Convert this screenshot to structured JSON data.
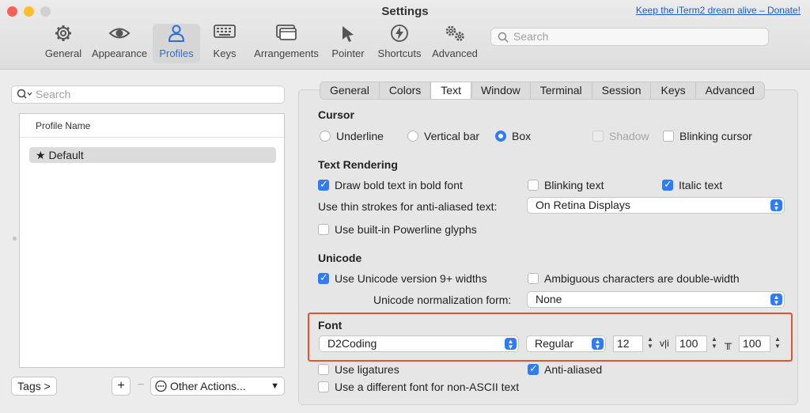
{
  "window": {
    "title": "Settings",
    "donate_link": "Keep the iTerm2 dream alive – Donate!"
  },
  "toolbar": {
    "items": [
      {
        "label": "General",
        "icon": "gear-icon"
      },
      {
        "label": "Appearance",
        "icon": "eye-icon"
      },
      {
        "label": "Profiles",
        "icon": "person-icon"
      },
      {
        "label": "Keys",
        "icon": "keyboard-icon"
      },
      {
        "label": "Arrangements",
        "icon": "windows-icon"
      },
      {
        "label": "Pointer",
        "icon": "pointer-icon"
      },
      {
        "label": "Shortcuts",
        "icon": "bolt-icon"
      },
      {
        "label": "Advanced",
        "icon": "gears-icon"
      }
    ],
    "selected": "Profiles",
    "search_placeholder": "Search"
  },
  "profiles": {
    "search_placeholder": "Search",
    "column_header": "Profile Name",
    "items": [
      {
        "name": "Default",
        "star": "★"
      }
    ],
    "tags_button": "Tags >",
    "add_button": "+",
    "remove_button": "−",
    "other_actions": "Other Actions..."
  },
  "tabs": [
    "General",
    "Colors",
    "Text",
    "Window",
    "Terminal",
    "Session",
    "Keys",
    "Advanced"
  ],
  "active_tab": "Text",
  "cursor": {
    "title": "Cursor",
    "options": [
      "Underline",
      "Vertical bar",
      "Box"
    ],
    "selected": "Box",
    "shadow": "Shadow",
    "blinking": "Blinking cursor"
  },
  "text_rendering": {
    "title": "Text Rendering",
    "bold": "Draw bold text in bold font",
    "blinking_text": "Blinking text",
    "italic": "Italic text",
    "thin_strokes_label": "Use thin strokes for anti-aliased text:",
    "thin_strokes_value": "On Retina Displays",
    "powerline": "Use built-in Powerline glyphs"
  },
  "unicode": {
    "title": "Unicode",
    "v9_widths": "Use Unicode version 9+ widths",
    "ambiguous": "Ambiguous characters are double-width",
    "normalization_label": "Unicode normalization form:",
    "normalization_value": "None"
  },
  "font": {
    "title": "Font",
    "family": "D2Coding",
    "style": "Regular",
    "size": "12",
    "h_spacing_icon": "v|i",
    "h_spacing": "100",
    "v_spacing_icon": "╥",
    "v_spacing": "100",
    "ligatures": "Use ligatures",
    "anti_aliased": "Anti-aliased",
    "non_ascii": "Use a different font for non-ASCII text"
  },
  "colors": {
    "accent": "#2f7cf6",
    "highlight_box": "#e0552f",
    "link": "#1b5bd1"
  }
}
